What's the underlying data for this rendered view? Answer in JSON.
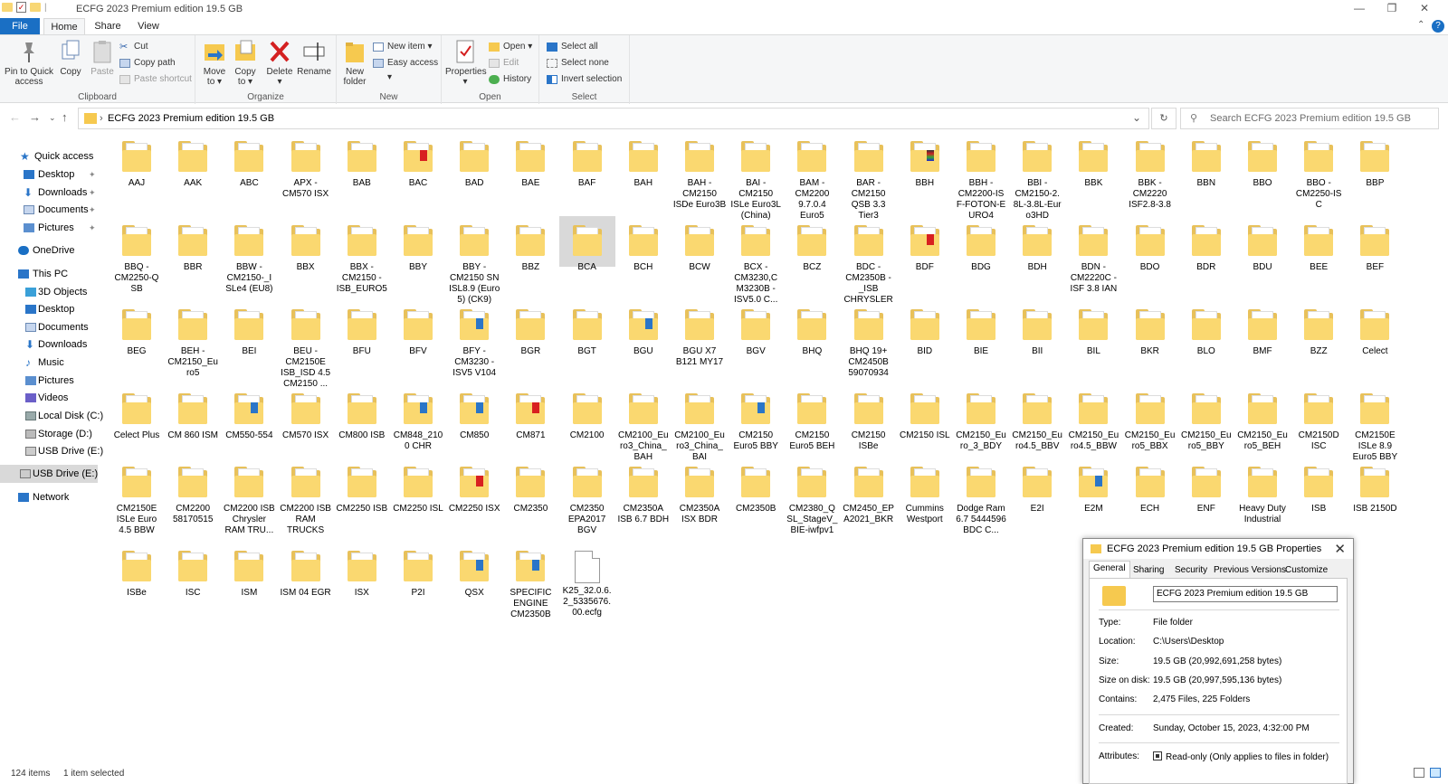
{
  "window": {
    "title": "ECFG 2023 Premium edition 19.5 GB",
    "controls": {
      "minimize": "—",
      "maximize": "❐",
      "close": "✕"
    }
  },
  "ribbon": {
    "tabs": {
      "file": "File",
      "home": "Home",
      "share": "Share",
      "view": "View"
    },
    "clipboard": {
      "pin": "Pin to Quick access",
      "copy": "Copy",
      "paste": "Paste",
      "cut": "Cut",
      "copy_path": "Copy path",
      "paste_shortcut": "Paste shortcut",
      "group": "Clipboard"
    },
    "organize": {
      "move_to": "Move to ▾",
      "copy_to": "Copy to ▾",
      "delete": "Delete ▾",
      "rename": "Rename",
      "group": "Organize"
    },
    "new": {
      "new_folder": "New folder",
      "new_item": "New item ▾",
      "easy_access": "Easy access ▾",
      "group": "New"
    },
    "open": {
      "properties": "Properties ▾",
      "open": "Open ▾",
      "edit": "Edit",
      "history": "History",
      "group": "Open"
    },
    "select": {
      "select_all": "Select all",
      "select_none": "Select none",
      "invert": "Invert selection",
      "group": "Select"
    }
  },
  "address": {
    "path": "ECFG 2023 Premium edition 19.5 GB",
    "search_placeholder": "Search ECFG 2023 Premium edition 19.5 GB"
  },
  "nav": {
    "quick_access": "Quick access",
    "desktop_pinned": "Desktop",
    "downloads_pinned": "Downloads",
    "documents_pinned": "Documents",
    "pictures_pinned": "Pictures",
    "onedrive": "OneDrive",
    "this_pc": "This PC",
    "objects3d": "3D Objects",
    "desktop": "Desktop",
    "documents": "Documents",
    "downloads": "Downloads",
    "music": "Music",
    "pictures": "Pictures",
    "videos": "Videos",
    "local_disk": "Local Disk (C:)",
    "storage": "Storage (D:)",
    "usb_drive": "USB Drive (E:)",
    "usb_drive_root": "USB Drive (E:)",
    "network": "Network"
  },
  "items": [
    [
      "AAJ",
      "AAK",
      "ABC",
      "APX - CM570 ISX",
      "BAB",
      "BAC",
      "BAD",
      "BAE",
      "BAF",
      "BAH",
      "BAH - CM2150 ISDe Euro3B",
      "BAI - CM2150 ISLe Euro3L (China)",
      "BAM - CM2200 9.7.0.4 Euro5",
      "BAR - CM2150 QSB 3.3 Tier3",
      "BBH",
      "BBH - CM2200-IS F-FOTON-E URO4",
      "BBI - CM2150-2. 8L-3.8L-Eur o3HD",
      "BBK",
      "BBK - CM2220 ISF2.8-3.8",
      "BBN",
      "BBO",
      "BBO - CM2250-IS C",
      "BBP"
    ],
    [
      "BBQ - CM2250-Q SB",
      "BBR",
      "BBW - CM2150-_I SLe4 (EU8)",
      "BBX",
      "BBX - CM2150 - ISB_EURO5",
      "BBY",
      "BBY - CM2150 SN ISL8.9 (Euro 5) (CK9)",
      "BBZ",
      "BCA",
      "BCH",
      "BCW",
      "BCX - CM3230,C M3230B - ISV5.0 C...",
      "BCZ",
      "BDC - CM2350B -_ISB CHRYSLER",
      "BDF",
      "BDG",
      "BDH",
      "BDN - CM2220C - ISF 3.8 IAN",
      "BDO",
      "BDR",
      "BDU",
      "BEE",
      "BEF"
    ],
    [
      "BEG",
      "BEH - CM2150_Eu ro5",
      "BEI",
      "BEU - CM2150E ISB_ISD 4.5 CM2150 ...",
      "BFU",
      "BFV",
      "BFY - CM3230 - ISV5 V104",
      "BGR",
      "BGT",
      "BGU",
      "BGU X7 B121 MY17",
      "BGV",
      "BHQ",
      "BHQ 19+ CM2450B 59070934",
      "BID",
      "BIE",
      "BII",
      "BIL",
      "BKR",
      "BLO",
      "BMF",
      "BZZ",
      "Celect"
    ],
    [
      "Celect Plus",
      "CM 860 ISM",
      "CM550-554",
      "CM570 ISX",
      "CM800 ISB",
      "CM848_210 0 CHR",
      "CM850",
      "CM871",
      "CM2100",
      "CM2100_Eu ro3_China_ BAH",
      "CM2100_Eu ro3_China_ BAI",
      "CM2150 Euro5 BBY",
      "CM2150 Euro5 BEH",
      "CM2150 ISBe",
      "CM2150 ISL",
      "CM2150_Eu ro_3_BDY",
      "CM2150_Eu ro4.5_BBV",
      "CM2150_Eu ro4.5_BBW",
      "CM2150_Eu ro5_BBX",
      "CM2150_Eu ro5_BBY",
      "CM2150_Eu ro5_BEH",
      "CM2150D ISC",
      "CM2150E ISLe 8.9 Euro5 BBY"
    ],
    [
      "CM2150E ISLe Euro 4.5 BBW",
      "CM2200 58170515",
      "CM2200 ISB Chrysler RAM TRU...",
      "CM2200 ISB RAM TRUCKS",
      "CM2250 ISB",
      "CM2250 ISL",
      "CM2250 ISX",
      "CM2350",
      "CM2350 EPA2017 BGV",
      "CM2350A ISB 6.7 BDH",
      "CM2350A ISX BDR",
      "CM2350B",
      "CM2380_Q SL_StageV_ BIE-iwfpv1",
      "CM2450_EP A2021_BKR",
      "Cummins Westport",
      "Dodge Ram 6.7 5444596 BDC C...",
      "E2I",
      "E2M",
      "ECH",
      "ENF",
      "Heavy Duty Industrial",
      "ISB",
      "ISB 2150D"
    ],
    [
      "ISBe",
      "ISC",
      "ISM",
      "ISM 04 EGR",
      "ISX",
      "P2I",
      "QSX",
      "SPECIFIC ENGINE CM2350B",
      "K25_32.0.6. 2_5335676. 00.ecfg"
    ]
  ],
  "status": {
    "count": "124 items",
    "selected": "1 item selected"
  },
  "properties": {
    "title": "ECFG 2023 Premium edition 19.5 GB Properties",
    "tabs": [
      "General",
      "Sharing",
      "Security",
      "Previous Versions",
      "Customize"
    ],
    "name": "ECFG 2023 Premium edition 19.5 GB",
    "type_label": "Type:",
    "type": "File folder",
    "location_label": "Location:",
    "location": "C:\\Users\\Desktop",
    "size_label": "Size:",
    "size": "19.5 GB (20,992,691,258 bytes)",
    "size_disk_label": "Size on disk:",
    "size_disk": "19.5 GB (20,997,595,136 bytes)",
    "contains_label": "Contains:",
    "contains": "2,475 Files, 225 Folders",
    "created_label": "Created:",
    "created": "Sunday, October 15, 2023, 4:32:00 PM",
    "attributes_label": "Attributes:",
    "readonly": "Read-only (Only applies to files in folder)"
  }
}
